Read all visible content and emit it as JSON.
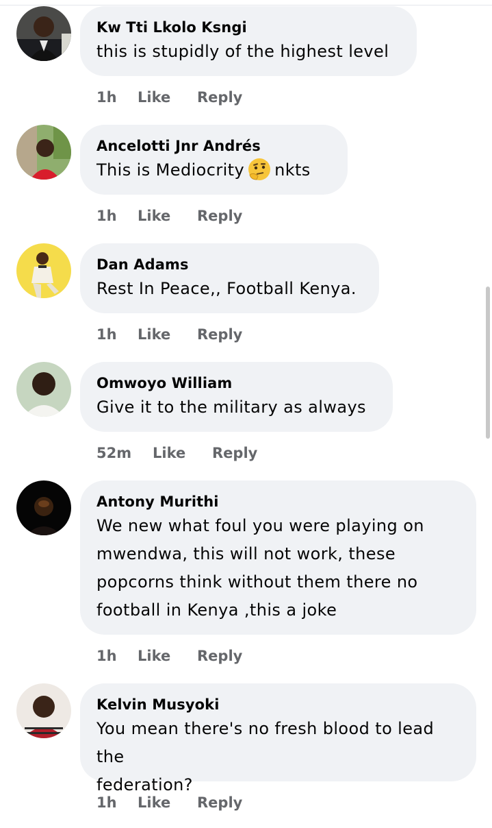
{
  "comments": [
    {
      "author": "Kw Tti Lkolo Ksngi",
      "text": "this is stupidly of the highest level",
      "time": "1h",
      "like": "Like",
      "reply": "Reply"
    },
    {
      "author": "Ancelotti Jnr Andrés",
      "text_before": "This is Mediocrity",
      "emoji": "thinking-face-emoji",
      "text_after": "nkts",
      "time": "1h",
      "like": "Like",
      "reply": "Reply"
    },
    {
      "author": "Dan Adams",
      "text": "Rest In Peace,, Football Kenya.",
      "time": "1h",
      "like": "Like",
      "reply": "Reply"
    },
    {
      "author": "Omwoyo William",
      "text": "Give it to the military as always",
      "time": "52m",
      "like": "Like",
      "reply": "Reply"
    },
    {
      "author": "Antony Murithi",
      "lines": [
        "We new what foul you were playing on",
        "mwendwa, this will not work, these",
        "popcorns think without them there no",
        "football in Kenya ,this a joke"
      ],
      "time": "1h",
      "like": "Like",
      "reply": "Reply"
    },
    {
      "author": "Kelvin Musyoki",
      "lines": [
        "You mean there's no fresh blood to lead the",
        "federation?"
      ],
      "time": "1h",
      "like": "Like",
      "reply": "Reply"
    }
  ],
  "colors": {
    "bubble": "#f0f2f5",
    "meta": "#65676b",
    "text": "#050505"
  }
}
